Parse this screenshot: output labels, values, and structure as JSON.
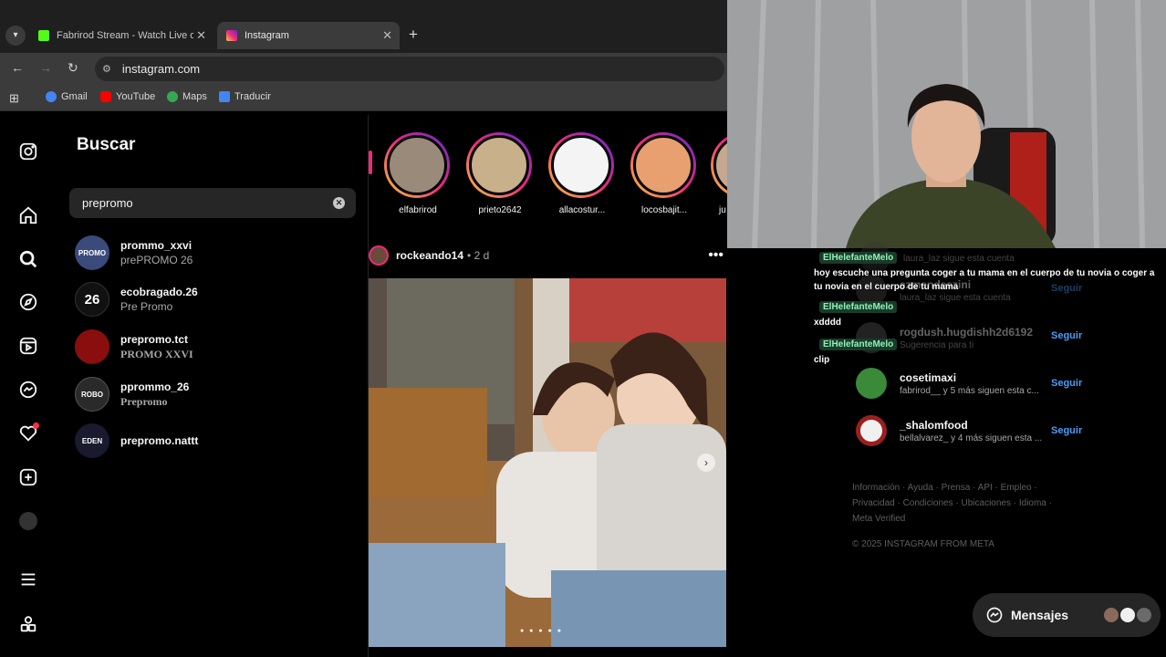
{
  "browser": {
    "tabs": [
      {
        "label": "Fabrirod Stream - Watch Live o",
        "favicon": "kick-icon",
        "color": "#53fc18"
      },
      {
        "label": "Instagram",
        "favicon": "instagram-icon",
        "color": "#e1306c"
      }
    ],
    "new_tab": "+",
    "url": "instagram.com",
    "bookmarks": [
      {
        "label": "Gmail",
        "icon": "google-icon",
        "color": "#4285f4"
      },
      {
        "label": "YouTube",
        "icon": "youtube-icon",
        "color": "#ff0000"
      },
      {
        "label": "Maps",
        "icon": "maps-pin-icon",
        "color": "#34a853"
      },
      {
        "label": "Traducir",
        "icon": "translate-icon",
        "color": "#4285f4"
      }
    ]
  },
  "search": {
    "title": "Buscar",
    "query": "prepromo",
    "results": [
      {
        "username": "prommo_xxvi",
        "name": "prePROMO 26",
        "avatar_text": "PROMO",
        "color": "#3a4a7a"
      },
      {
        "username": "ecobragado.26",
        "name": "Pre Promo",
        "avatar_text": "26",
        "color": "#111111"
      },
      {
        "username": "prepromo.tct",
        "name": "PROMO XXVI",
        "avatar_text": "",
        "color": "#8b0e0e"
      },
      {
        "username": "pprommo_26",
        "name": "Prepromo",
        "avatar_text": "ROBO",
        "color": "#2a2a2a"
      },
      {
        "username": "prepromo.nattt",
        "name": "",
        "avatar_text": "EDEN",
        "color": "#1a1a2e"
      }
    ]
  },
  "stories": [
    {
      "name": "elfabrirod",
      "color": "#9a8a7a"
    },
    {
      "name": "prieto2642",
      "color": "#c8b08a"
    },
    {
      "name": "allacostur...",
      "color": "#f4f4f4"
    },
    {
      "name": "locosbajit...",
      "color": "#e8a070"
    },
    {
      "name": "ju",
      "color": "#c4a890"
    }
  ],
  "post": {
    "username": "rockeando14",
    "time": "• 2 d",
    "more": "•••"
  },
  "chat": [
    {
      "user": "ElHelefanteMelo",
      "message": "hoy escuche una pregunta coger a tu mama en el cuerpo de tu novia o coger a tu novia en el cuerpo de tu mama"
    },
    {
      "user": "ElHelefanteMelo",
      "message": "xdddd"
    },
    {
      "user": "ElHelefanteMelo",
      "message": "clip"
    }
  ],
  "suggestions": [
    {
      "username": "laura_laz sigue esta cuenta",
      "sub": "",
      "follow": "",
      "faded": true
    },
    {
      "username": "ezmendeszini",
      "sub": "laura_laz sigue esta cuenta",
      "follow": "Seguir",
      "faded": true
    },
    {
      "username": "rogdush.hugdishh2d6192",
      "sub": "Sugerencia para ti",
      "follow": "Seguir",
      "faded": true
    },
    {
      "username": "cosetimaxi",
      "sub": "fabrirod__ y 5 más siguen esta c...",
      "follow": "Seguir",
      "faded": false
    },
    {
      "username": "_shalomfood",
      "sub": "bellalvarez_ y 4 más siguen esta ...",
      "follow": "Seguir",
      "faded": false
    }
  ],
  "footer": {
    "links": "Información · Ayuda · Prensa · API · Empleo · Privacidad · Condiciones · Ubicaciones · Idioma · Meta Verified",
    "copyright": "© 2025 INSTAGRAM FROM META"
  },
  "messages": {
    "label": "Mensajes"
  }
}
